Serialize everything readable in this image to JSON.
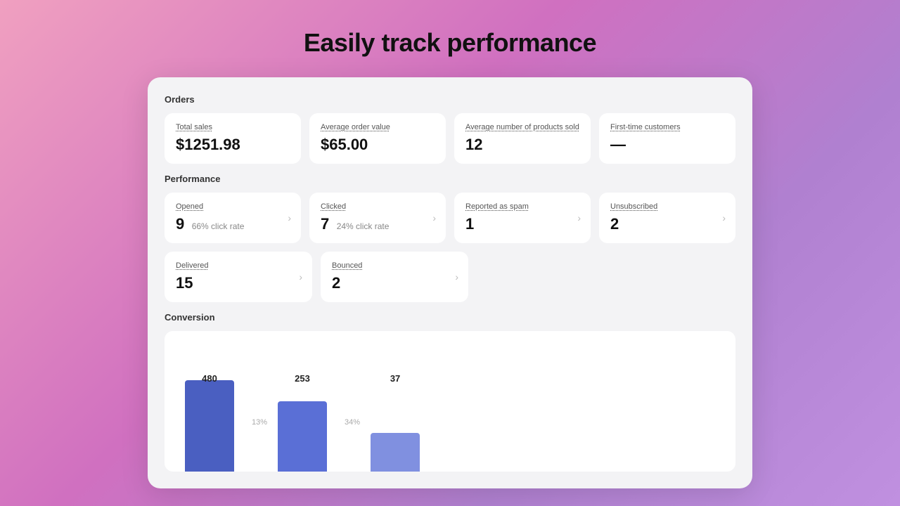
{
  "page": {
    "title": "Easily track performance"
  },
  "orders": {
    "section_label": "Orders",
    "cards": [
      {
        "id": "total-sales",
        "title": "Total sales",
        "value": "$1251.98",
        "sub": "",
        "arrow": true
      },
      {
        "id": "avg-order-value",
        "title": "Average order value",
        "value": "$65.00",
        "sub": "",
        "arrow": false
      },
      {
        "id": "avg-products-sold",
        "title": "Average number of products sold",
        "value": "12",
        "sub": "",
        "arrow": false
      },
      {
        "id": "first-time-customers",
        "title": "First-time customers",
        "value": "—",
        "sub": "",
        "arrow": false
      }
    ]
  },
  "performance": {
    "section_label": "Performance",
    "row1": [
      {
        "id": "opened",
        "title": "Opened",
        "value": "9",
        "sub": "66% click rate",
        "arrow": true
      },
      {
        "id": "clicked",
        "title": "Clicked",
        "value": "7",
        "sub": "24% click rate",
        "arrow": true
      },
      {
        "id": "reported-spam",
        "title": "Reported as spam",
        "value": "1",
        "sub": "",
        "arrow": true
      },
      {
        "id": "unsubscribed",
        "title": "Unsubscribed",
        "value": "2",
        "sub": "",
        "arrow": true
      }
    ],
    "row2": [
      {
        "id": "delivered",
        "title": "Delivered",
        "value": "15",
        "sub": "",
        "arrow": true
      },
      {
        "id": "bounced",
        "title": "Bounced",
        "value": "2",
        "sub": "",
        "arrow": true
      }
    ]
  },
  "conversion": {
    "section_label": "Conversion",
    "bars": [
      {
        "id": "bar1",
        "value": 480,
        "pct": null,
        "height": 130,
        "color": "bar-blue-dark",
        "width": 70
      },
      {
        "id": "bar2",
        "value": 253,
        "pct": "13%",
        "height": 100,
        "color": "bar-blue-mid",
        "width": 70
      },
      {
        "id": "bar3",
        "value": 37,
        "pct": "34%",
        "height": 60,
        "color": "bar-blue-light",
        "width": 70
      }
    ]
  }
}
